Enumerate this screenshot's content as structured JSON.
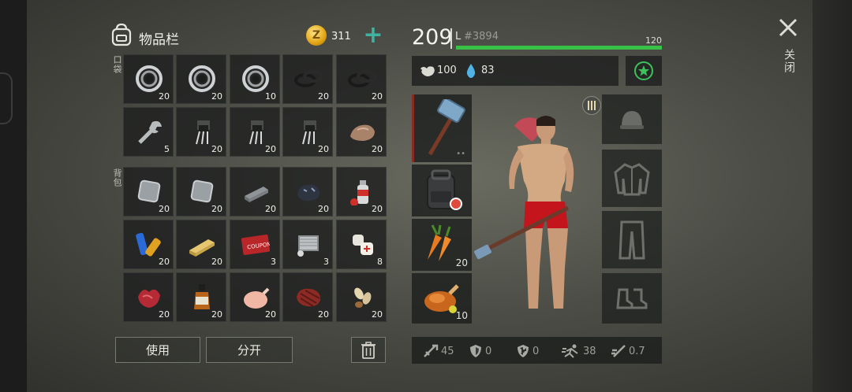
{
  "header": {
    "title": "物品栏",
    "coins": "311",
    "add_label": "+"
  },
  "sections": {
    "pockets": "口袋",
    "backpack": "背包"
  },
  "pocket_slots": [
    {
      "icon": "bearing-icon",
      "qty": "20"
    },
    {
      "icon": "bearing-icon",
      "qty": "20"
    },
    {
      "icon": "bearing-icon",
      "qty": "10"
    },
    {
      "icon": "rubber-seal-icon",
      "qty": "20"
    },
    {
      "icon": "rubber-seal-icon",
      "qty": "20"
    },
    {
      "icon": "wrench-icon",
      "qty": "5"
    },
    {
      "icon": "transistor-icon",
      "qty": "20"
    },
    {
      "icon": "transistor-icon",
      "qty": "20"
    },
    {
      "icon": "transistor-icon",
      "qty": "20"
    },
    {
      "icon": "stone-icon",
      "qty": "20"
    }
  ],
  "backpack_slots": [
    {
      "icon": "metal-plate-icon",
      "qty": "20"
    },
    {
      "icon": "metal-plate-icon",
      "qty": "20"
    },
    {
      "icon": "iron-ingot-icon",
      "qty": "20"
    },
    {
      "icon": "coal-ore-icon",
      "qty": "20"
    },
    {
      "icon": "spray-paint-icon",
      "qty": "20"
    },
    {
      "icon": "batteries-icon",
      "qty": "20"
    },
    {
      "icon": "gold-bar-icon",
      "qty": "20"
    },
    {
      "icon": "combat-coupon-icon",
      "qty": "3",
      "text": "COUPON"
    },
    {
      "icon": "engine-part-icon",
      "qty": "3"
    },
    {
      "icon": "bandage-icon",
      "qty": "8"
    },
    {
      "icon": "raw-meat-icon",
      "qty": "20"
    },
    {
      "icon": "whiskey-bottle-icon",
      "qty": "20"
    },
    {
      "icon": "raw-chicken-icon",
      "qty": "20"
    },
    {
      "icon": "steak-icon",
      "qty": "20"
    },
    {
      "icon": "seeds-icon",
      "qty": "20"
    }
  ],
  "actions": {
    "use": "使用",
    "split": "分开"
  },
  "character": {
    "level": "209",
    "xp_prefix": "L",
    "xp_id": "#3894",
    "xp_max": "120",
    "xp_fraction": 1.0,
    "food": "100",
    "water": "83"
  },
  "equipment": [
    {
      "icon": "sledgehammer-icon",
      "qty": ""
    },
    {
      "icon": "backpack-icon",
      "qty": ""
    },
    {
      "icon": "carrots-icon",
      "qty": "20"
    },
    {
      "icon": "roast-chicken-icon",
      "qty": "10"
    }
  ],
  "gear": [
    "helmet-icon",
    "jacket-icon",
    "pants-icon",
    "boots-icon"
  ],
  "stats": [
    {
      "icon": "attack-icon",
      "value": "45"
    },
    {
      "icon": "defense-icon",
      "value": "0"
    },
    {
      "icon": "radiation-icon",
      "value": "0"
    },
    {
      "icon": "speed-icon",
      "value": "38"
    },
    {
      "icon": "attack-speed-icon",
      "value": "0.7"
    }
  ],
  "close_label": "关闭",
  "colors": {
    "accent_teal": "#3fb3a1",
    "xp_green": "#37c146",
    "coin_gold": "#e1a412"
  }
}
